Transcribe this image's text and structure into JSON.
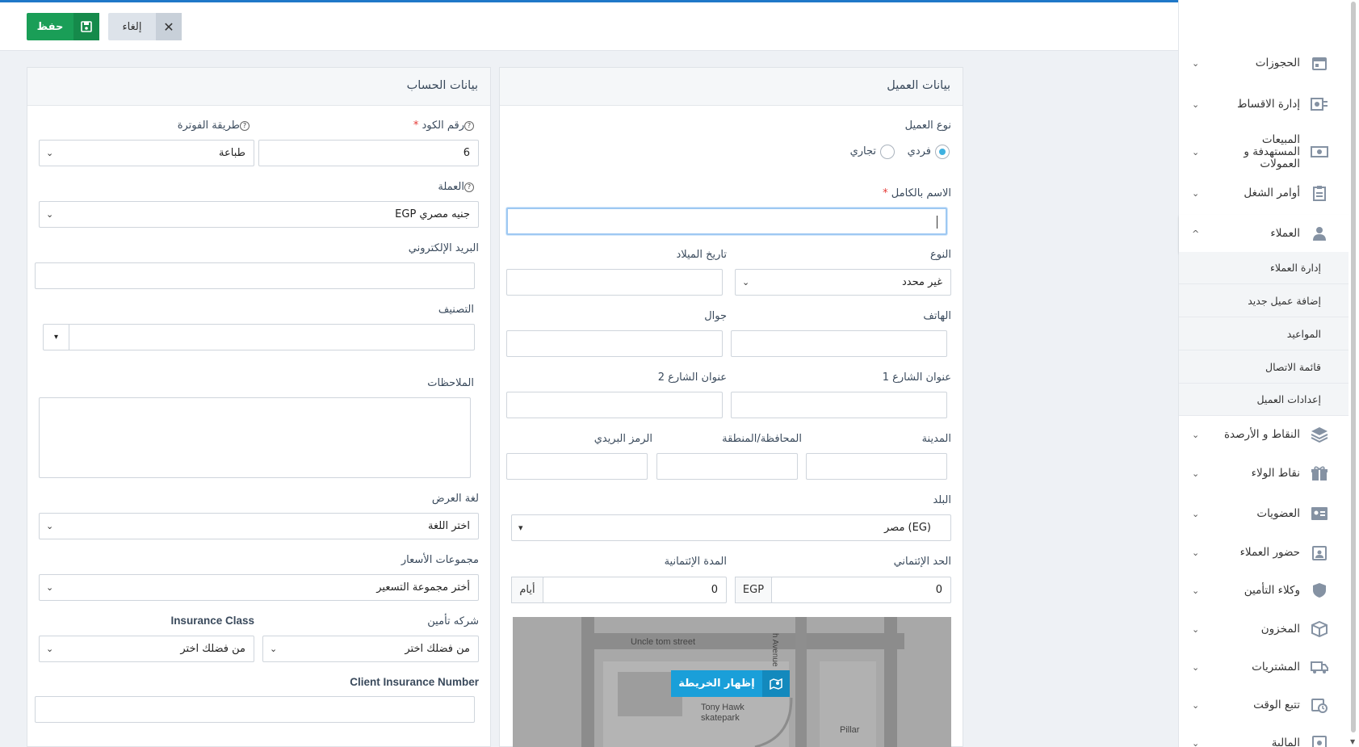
{
  "toolbar": {
    "save_label": "حفظ",
    "cancel_label": "إلغاء"
  },
  "client_panel": {
    "title": "بيانات العميل",
    "client_type_label": "نوع العميل",
    "type_individual": "فردي",
    "type_commercial": "تجاري",
    "fullname_label": "الاسم بالكامل",
    "fullname_value": "",
    "gender_label": "النوع",
    "gender_value": "غير محدد",
    "birthdate_label": "تاريخ الميلاد",
    "phone_label": "الهاتف",
    "mobile_label": "جوال",
    "street1_label": "عنوان الشارع 1",
    "street2_label": "عنوان الشارع 2",
    "city_label": "المدينة",
    "state_label": "المحافظة/المنطقة",
    "zip_label": "الرمز البريدي",
    "country_label": "البلد",
    "country_value": "مصر (EG)",
    "credit_limit_label": "الحد الإئتماني",
    "credit_limit_value": "0",
    "credit_currency": "EGP",
    "credit_period_label": "المدة الإئتمانية",
    "credit_period_value": "0",
    "credit_period_unit": "أيام",
    "map_button_label": "إظهار الخريطة",
    "map_streets": [
      "Uncle tom street",
      "h Avenue",
      "Tony Hawk",
      "skatepark",
      "Pillar"
    ]
  },
  "account_panel": {
    "title": "بيانات الحساب",
    "code_label": "رقم الكود",
    "code_value": "6",
    "invoice_method_label": "طريقة الفوترة",
    "invoice_method_value": "طباعة",
    "currency_label": "العملة",
    "currency_value": "EGP جنيه مصري",
    "email_label": "البريد الإلكتروني",
    "category_label": "التصنيف",
    "notes_label": "الملاحظات",
    "language_label": "لغة العرض",
    "language_value": "اختر اللغة",
    "price_groups_label": "مجموعات الأسعار",
    "price_groups_value": "أختر مجموعة التسعير",
    "insurance_company_label": "شركه تأمين",
    "insurance_company_value": "من فضلك اختر",
    "insurance_class_label": "Insurance Class",
    "insurance_class_value": "من فضلك اختر",
    "insurance_number_label": "Client Insurance Number"
  },
  "sidebar": {
    "items": [
      {
        "label": "الحجوزات",
        "icon": "calendar-icon"
      },
      {
        "label": "إدارة الاقساط",
        "icon": "installments-icon"
      },
      {
        "label": "المبيعات المستهدفة و العمولات",
        "icon": "money-icon"
      },
      {
        "label": "أوامر الشغل",
        "icon": "clipboard-icon"
      },
      {
        "label": "العملاء",
        "icon": "user-icon"
      },
      {
        "label": "النقاط و الأرصدة",
        "icon": "layers-icon"
      },
      {
        "label": "نقاط الولاء",
        "icon": "gift-icon"
      },
      {
        "label": "العضويات",
        "icon": "id-card-icon"
      },
      {
        "label": "حضور العملاء",
        "icon": "attendance-icon"
      },
      {
        "label": "وكلاء التأمين",
        "icon": "shield-icon"
      },
      {
        "label": "المخزون",
        "icon": "box-icon"
      },
      {
        "label": "المشتريات",
        "icon": "truck-icon"
      },
      {
        "label": "تتبع الوقت",
        "icon": "clock-icon"
      },
      {
        "label": "المالية",
        "icon": "finance-icon"
      }
    ],
    "subitems": [
      "إدارة العملاء",
      "إضافة عميل جديد",
      "المواعيد",
      "قائمة الاتصال",
      "إعدادات العميل"
    ]
  }
}
